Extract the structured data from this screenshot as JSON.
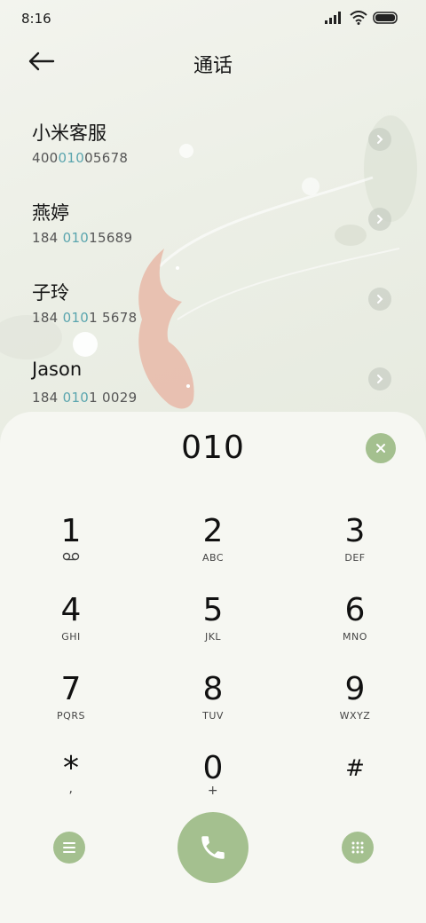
{
  "status_bar": {
    "time": "8:16"
  },
  "header": {
    "title": "通话"
  },
  "contacts": [
    {
      "name": "小米客服",
      "number_pre": "400",
      "number_match": "010",
      "number_post": "05678"
    },
    {
      "name": "燕婷",
      "number_pre": "184 ",
      "number_match": "010",
      "number_post": "15689"
    },
    {
      "name": "子玲",
      "number_pre": "184 ",
      "number_match": "010",
      "number_post": "1 5678"
    },
    {
      "name": "Jason",
      "number_pre": "184 ",
      "number_match": "010",
      "number_post": "1 0029"
    }
  ],
  "dialpad": {
    "display": "010",
    "keys": [
      {
        "digit": "1",
        "sub": ""
      },
      {
        "digit": "2",
        "sub": "ABC"
      },
      {
        "digit": "3",
        "sub": "DEF"
      },
      {
        "digit": "4",
        "sub": "GHI"
      },
      {
        "digit": "5",
        "sub": "JKL"
      },
      {
        "digit": "6",
        "sub": "MNO"
      },
      {
        "digit": "7",
        "sub": "PQRS"
      },
      {
        "digit": "8",
        "sub": "TUV"
      },
      {
        "digit": "9",
        "sub": "WXYZ"
      },
      {
        "digit": "*",
        "sub": ","
      },
      {
        "digit": "0",
        "sub": "+"
      },
      {
        "digit": "#",
        "sub": ""
      }
    ]
  },
  "colors": {
    "accent": "#a4c08f",
    "match_highlight": "#5aa5ae",
    "panel": "#f6f7f2"
  },
  "icons": [
    "back-arrow-icon",
    "chevron-right-icon",
    "clear-icon",
    "voicemail-icon",
    "menu-icon",
    "phone-icon",
    "keypad-icon"
  ]
}
